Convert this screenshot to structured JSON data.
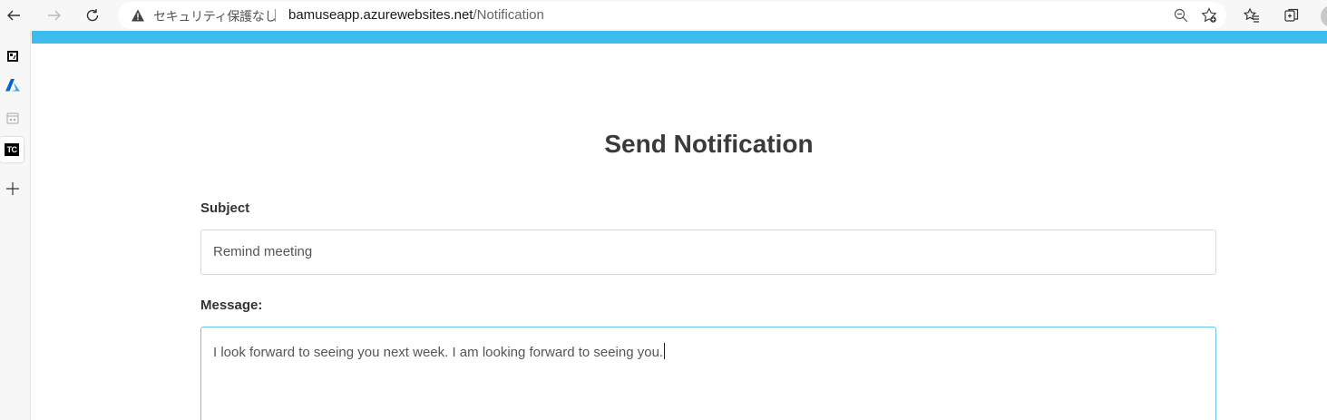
{
  "browser": {
    "security_label": "セキュリティ保護なし",
    "url_host": "bamuseapp.azurewebsites.net",
    "url_path": "/Notification",
    "icons": [
      "back-icon",
      "forward-icon",
      "refresh-icon",
      "warning-icon",
      "zoom-out-icon",
      "add-favorite-icon",
      "favorites-icon",
      "collections-icon",
      "profile-icon"
    ]
  },
  "sidebar": {
    "items": [
      {
        "icon": "app-icon"
      },
      {
        "icon": "azure-icon"
      },
      {
        "icon": "calendar-icon"
      },
      {
        "icon": "tc-icon",
        "label": "TC"
      },
      {
        "icon": "add-icon"
      }
    ]
  },
  "page": {
    "accent_color": "#3bbcec",
    "title": "Send Notification",
    "subject_label": "Subject",
    "subject_value": "Remind meeting",
    "message_label": "Message:",
    "message_value": "I look forward to seeing you next week. I am looking forward to seeing you."
  }
}
